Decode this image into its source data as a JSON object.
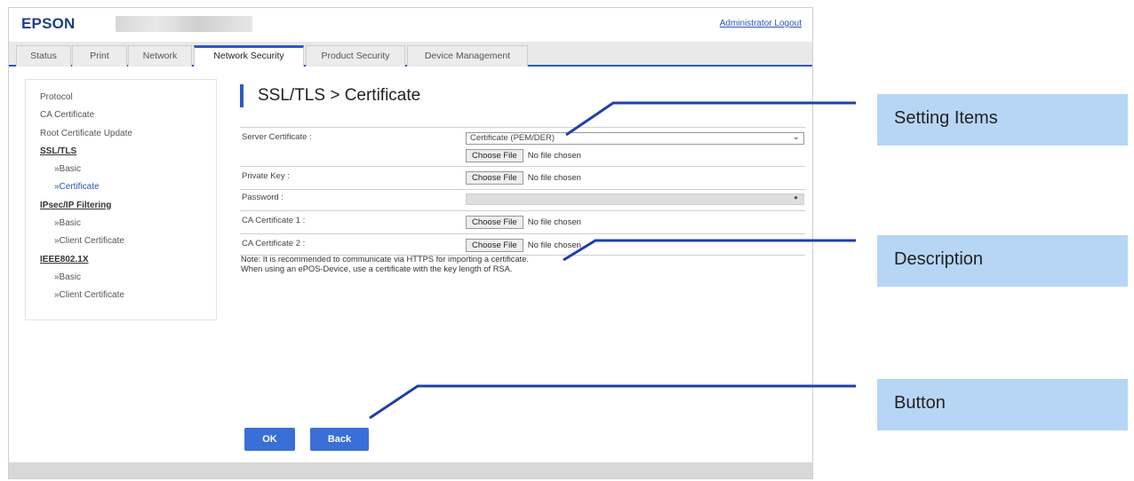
{
  "header": {
    "logo": "EPSON",
    "logout": "Administrator Logout"
  },
  "tabs": [
    "Status",
    "Print",
    "Network",
    "Network Security",
    "Product Security",
    "Device Management"
  ],
  "active_tab": "Network Security",
  "sidebar": {
    "items": [
      {
        "label": "Protocol"
      },
      {
        "label": "CA Certificate"
      },
      {
        "label": "Root Certificate Update"
      },
      {
        "label": "SSL/TLS"
      },
      {
        "label": "»Basic"
      },
      {
        "label": "»Certificate"
      },
      {
        "label": "IPsec/IP Filtering"
      },
      {
        "label": "»Basic"
      },
      {
        "label": "»Client Certificate"
      },
      {
        "label": "IEEE802.1X"
      },
      {
        "label": "»Basic"
      },
      {
        "label": "»Client Certificate"
      }
    ]
  },
  "page_title": "SSL/TLS > Certificate",
  "form": {
    "server_certificate_label": "Server Certificate :",
    "server_certificate_value": "Certificate (PEM/DER)",
    "private_key_label": "Private Key :",
    "password_label": "Password :",
    "ca_cert1_label": "CA Certificate 1 :",
    "ca_cert2_label": "CA Certificate 2 :",
    "choose_file": "Choose File",
    "no_file": "No file chosen"
  },
  "note": {
    "line1": "Note: It is recommended to communicate via HTTPS for importing a certificate.",
    "line2": "When using an ePOS-Device, use a certificate with the key length of RSA."
  },
  "buttons": {
    "ok": "OK",
    "back": "Back"
  },
  "callouts": {
    "setting_items": "Setting Items",
    "description": "Description",
    "button": "Button"
  },
  "colors": {
    "accent": "#2d59c4",
    "button": "#3a6fd8",
    "callout_bg": "#b7d6f5",
    "logo": "#1c3f8f"
  }
}
